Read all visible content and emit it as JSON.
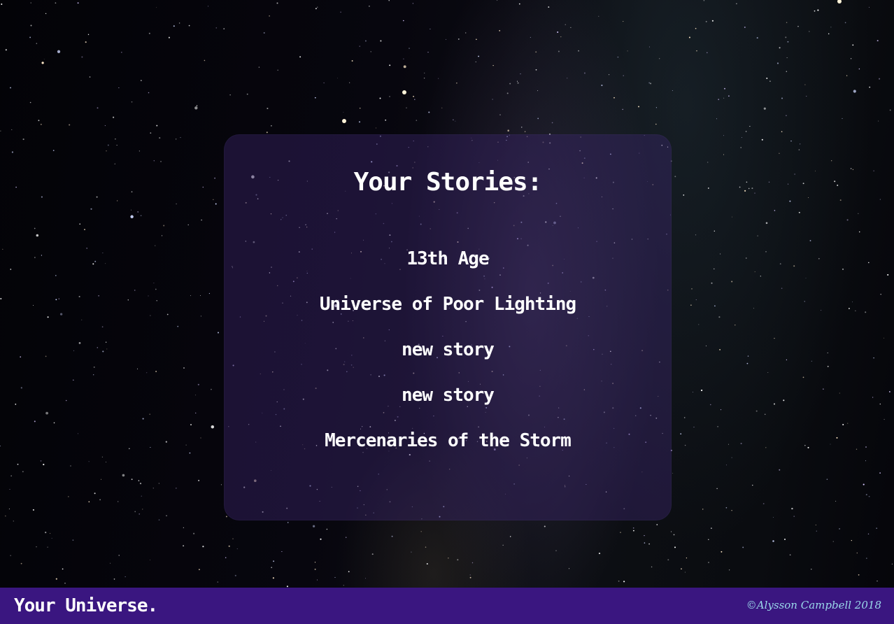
{
  "card": {
    "title": "Your Stories:",
    "stories": [
      "13th Age",
      "Universe of Poor Lighting",
      "new story",
      "new story",
      "Mercenaries of the Storm"
    ]
  },
  "footer": {
    "brand": "Your Universe.",
    "credit": "©Alysson Campbell 2018"
  },
  "colors": {
    "card_background": "#3c266e",
    "footer_background": "#3a1680",
    "credit_text": "#9ad8ea",
    "text": "#ffffff"
  }
}
